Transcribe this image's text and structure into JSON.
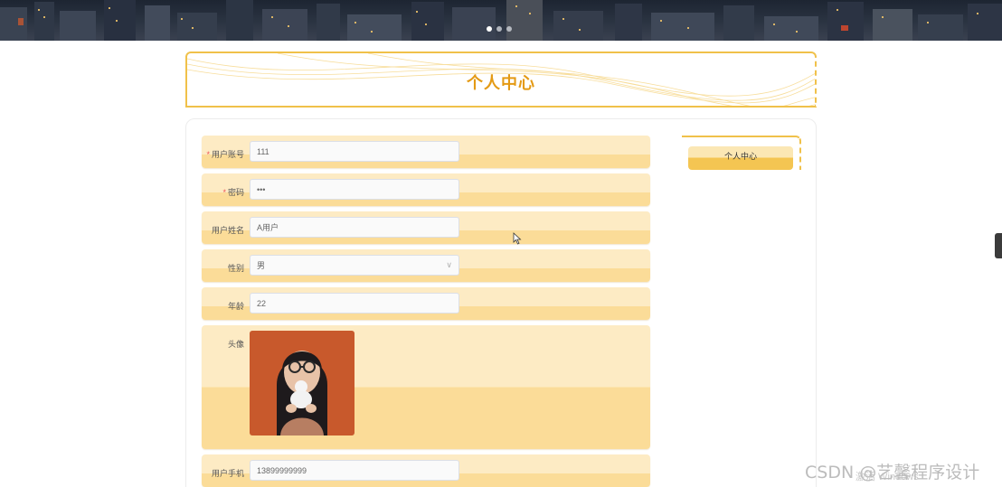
{
  "header": {
    "title": "个人中心"
  },
  "form": {
    "account": {
      "label": "用户账号",
      "required": "*",
      "value": "111"
    },
    "password": {
      "label": "密码",
      "required": "*",
      "value": "•••"
    },
    "name": {
      "label": "用户姓名",
      "value": "A用户"
    },
    "gender": {
      "label": "性别",
      "value": "男"
    },
    "age": {
      "label": "年龄",
      "value": "22"
    },
    "avatar": {
      "label": "头像"
    },
    "phone": {
      "label": "用户手机",
      "value": "13899999999"
    }
  },
  "sidebar": {
    "item_label": "个人中心"
  },
  "overlay": {
    "watermark": "CSDN @艺馨程序设计",
    "windows_text": "激活 Windows"
  },
  "colors": {
    "accent": "#f0c14a",
    "title": "#e49a14",
    "row_light": "#fdebc4",
    "row_dark": "#fbdc98",
    "required": "#f05454"
  },
  "icons": {
    "gender_select": "chevron-down-icon"
  }
}
